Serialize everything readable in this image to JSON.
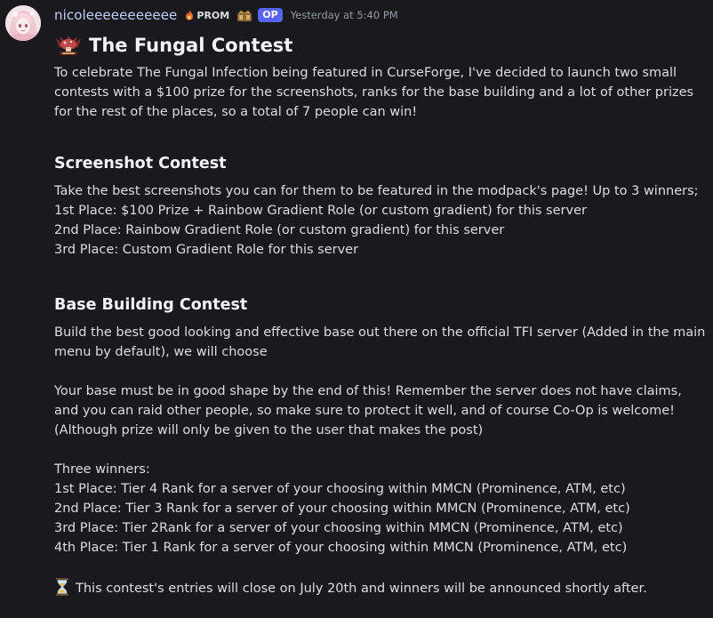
{
  "message": {
    "author": "nicoleeeeeeeeeee",
    "role_tag": "PROM",
    "op_badge": "OP",
    "timestamp": "Yesterday at 5:40 PM",
    "icons": {
      "avatar": "anime-girl-avatar",
      "role_tag_icon": "flame-icon",
      "badge": "badge-icon",
      "title_icon": "mushroom-emblem-icon",
      "closing_icon": "hourglass-icon"
    },
    "title": "The Fungal Contest",
    "intro": "To celebrate The Fungal Infection being featured in CurseForge, I've decided to launch two small contests with a $100 prize for the screenshots, ranks for the base building and a lot of other prizes for the rest of the places, so a total of 7 people can win!",
    "screenshot_contest": {
      "heading": "Screenshot Contest",
      "lines": [
        "Take the best screenshots you can for them to be featured in the modpack's page! Up to 3 winners;",
        "1st Place: $100 Prize + Rainbow Gradient Role (or custom gradient) for this server",
        "2nd Place: Rainbow Gradient Role (or custom gradient) for this server",
        "3rd Place: Custom Gradient Role for this server"
      ]
    },
    "base_contest": {
      "heading": "Base Building Contest",
      "intro": "Build the best good looking and effective base out there on the official TFI server (Added in the main menu by default), we will choose",
      "rules": "Your base must be in good shape by the end of this! Remember the server does not have claims, and you can raid other people, so make sure to protect it well, and of course Co-Op is welcome! (Although prize will only be given to the user that makes the post)",
      "winners_label": "Three winners:",
      "places": [
        "1st Place: Tier 4 Rank for a server of your choosing within MMCN (Prominence, ATM, etc)",
        "2nd Place: Tier 3 Rank for a server of your choosing within MMCN (Prominence, ATM, etc)",
        "3rd Place: Tier 2Rank for a server of your choosing within MMCN (Prominence, ATM, etc)",
        "4th Place: Tier 1 Rank for a server of your choosing within MMCN (Prominence, ATM, etc)"
      ]
    },
    "closing": "This contest's entries will close on July 20th and winners will be announced shortly after."
  },
  "colors": {
    "background": "#1a1a1e",
    "username": "#c6cbff",
    "op_badge": "#5865f2",
    "text": "#dbdee1",
    "heading": "#f2f3f5",
    "timestamp": "#949ba4"
  }
}
